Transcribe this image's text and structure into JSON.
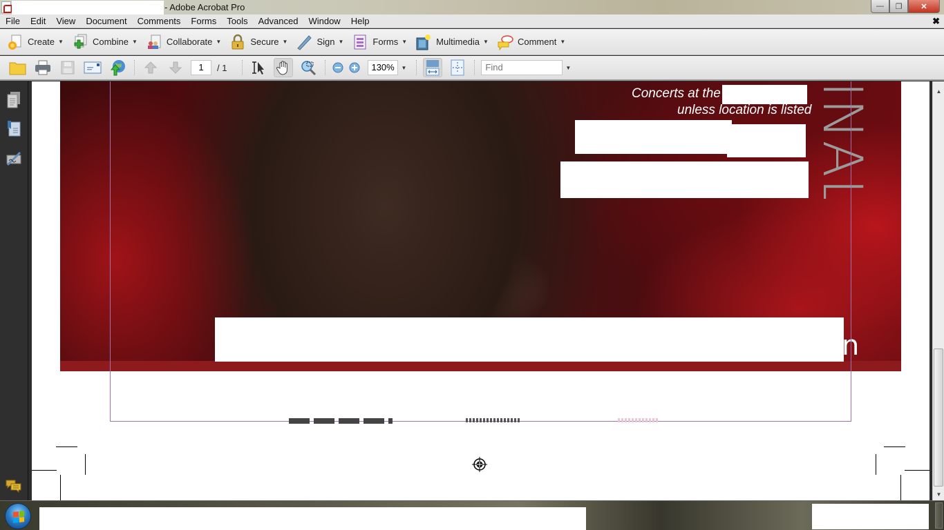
{
  "window": {
    "title_suffix": "- Adobe Acrobat Pro",
    "controls": {
      "minimize": "—",
      "restore": "❐",
      "close": "✕"
    }
  },
  "menubar": {
    "items": [
      "File",
      "Edit",
      "View",
      "Document",
      "Comments",
      "Forms",
      "Tools",
      "Advanced",
      "Window",
      "Help"
    ],
    "close_glyph": "✖"
  },
  "task_toolbar": {
    "buttons": [
      {
        "label": "Create",
        "icon": "create-icon"
      },
      {
        "label": "Combine",
        "icon": "combine-icon"
      },
      {
        "label": "Collaborate",
        "icon": "collaborate-icon"
      },
      {
        "label": "Secure",
        "icon": "lock-icon"
      },
      {
        "label": "Sign",
        "icon": "pen-icon"
      },
      {
        "label": "Forms",
        "icon": "forms-icon"
      },
      {
        "label": "Multimedia",
        "icon": "multimedia-icon"
      },
      {
        "label": "Comment",
        "icon": "comment-bubble-icon"
      }
    ],
    "caret": "▼"
  },
  "file_toolbar": {
    "current_page": "1",
    "total_pages": "/ 1",
    "zoom": "130%",
    "find_placeholder": "Find",
    "caret": "▼"
  },
  "nav_panel": {
    "icons": [
      "pages-icon",
      "bookmarks-icon",
      "signatures-icon",
      "comments-icon"
    ]
  },
  "document": {
    "concert_line1": "Concerts at the",
    "concert_line2": "unless location is listed",
    "vertical_title": "INAL",
    "partial_heading": "n",
    "accent_color": "#8d1a1c",
    "guide_color": "#9b71b0"
  },
  "scrollbar": {
    "up": "▲",
    "down": "▼"
  }
}
